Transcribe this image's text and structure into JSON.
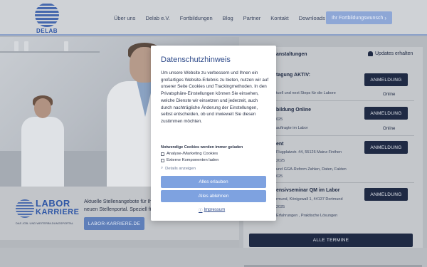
{
  "header": {
    "logo_text": "DELAB",
    "nav": [
      "Über uns",
      "Delab e.V.",
      "Fortbildungen",
      "Blog",
      "Partner",
      "Kontakt",
      "Downloads"
    ],
    "cta_label": "Ihr Fortbildungswunsch",
    "cta_chevron": "›"
  },
  "banner": {
    "logo_word1": "LABOR",
    "logo_word2": "KARRIERE",
    "logo_sub": "DAS JOB- UND WEITERBILDUNGSPORTAL",
    "text": "Aktuelle Stellenangebote für Ih neuen Stellenportal. Speziell fü",
    "button": "LABOR-KARRIERE.DE"
  },
  "events": {
    "heading": "anstaltungen",
    "updates_label": "Updates erhalten",
    "items": [
      {
        "title": "tagung AKTIV:",
        "meta1": "tuell und next Steps für die Labore",
        "meta2": "",
        "button": "ANMELDUNG",
        "badge": "Online"
      },
      {
        "title": "bildung Online",
        "meta1": "025",
        "meta2": "auftragte im Labor",
        "button": "ANMELDUNG",
        "badge": "Online"
      },
      {
        "title": "ent",
        "meta1": "Flugplatzstr. 44, 55126 Mainz-Finthen",
        "meta2": "2025",
        "meta3": "und GGA-Reform Zahlen, Daten, Fakten",
        "meta4": "025",
        "button": "ANMELDUNG",
        "badge": ""
      },
      {
        "title": "ensivseminar QM im Labor",
        "meta1": "rmund, Königswall 1, 44137 Dortmund",
        "meta2": "2025",
        "meta3": "Erfahrungen , Praktische Lösungen",
        "button": "ANMELDUNG",
        "badge": ""
      }
    ],
    "all_button": "ALLE TERMINE"
  },
  "modal": {
    "title": "Datenschutzhinweis",
    "body": "Um unsere Website zu verbessern und Ihnen ein großartiges Website-Erlebnis zu bieten, nutzen wir auf unserer Seite Cookies und Trackingmethoden. In den Privatsphäre-Einstellungen können Sie einsehen, welche Dienste wir einsetzen und jederzeit, auch durch nachträgliche Änderung der Einstellungen, selbst entscheiden, ob und inwieweit Sie diesen zustimmen möchten.",
    "subheading": "Notwendige Cookies werden immer geladen",
    "checkbox1": "Analyse-/Marketing Cookies",
    "checkbox2": "Externe Komponenten laden",
    "details": "Details anzeigen",
    "accept": "Alles erlauben",
    "reject": "Alles ablehnen",
    "impressum": "Impressum"
  }
}
